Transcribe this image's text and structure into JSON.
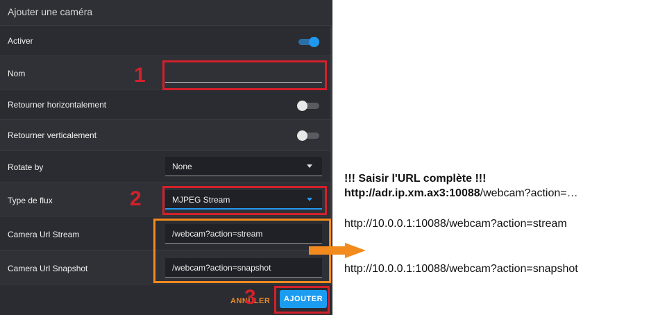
{
  "dialog": {
    "title": "Ajouter une caméra",
    "rows": {
      "activer": {
        "label": "Activer",
        "toggle": "on"
      },
      "nom": {
        "label": "Nom",
        "value": ""
      },
      "flip_h": {
        "label": "Retourner horizontalement",
        "toggle": "off"
      },
      "flip_v": {
        "label": "Retourner verticalement",
        "toggle": "off"
      },
      "rotate": {
        "label": "Rotate by",
        "value": "None"
      },
      "type_flux": {
        "label": "Type de flux",
        "value": "MJPEG Stream"
      },
      "url_stream": {
        "label": "Camera Url Stream",
        "value": "/webcam?action=stream"
      },
      "url_snapshot": {
        "label": "Camera Url Snapshot",
        "value": "/webcam?action=snapshot"
      }
    },
    "buttons": {
      "cancel": "ANNULER",
      "add": "AJOUTER"
    }
  },
  "annotations": {
    "markers": [
      "1",
      "2",
      "3"
    ],
    "headline": "!!! Saisir l'URL complète !!!",
    "url_host_bold": "http://adr.ip.xm.ax3:10088",
    "url_path": "/webcam?action=…",
    "example_stream": "http://10.0.0.1:10088/webcam?action=stream",
    "example_snapshot": "http://10.0.0.1:10088/webcam?action=snapshot"
  },
  "colors": {
    "dialog_bg": "#2b2c31",
    "accent_blue": "#1f98ee",
    "cancel_orange": "#e8892d",
    "highlight_red": "#d3202b",
    "highlight_orange": "#f28a1e"
  }
}
